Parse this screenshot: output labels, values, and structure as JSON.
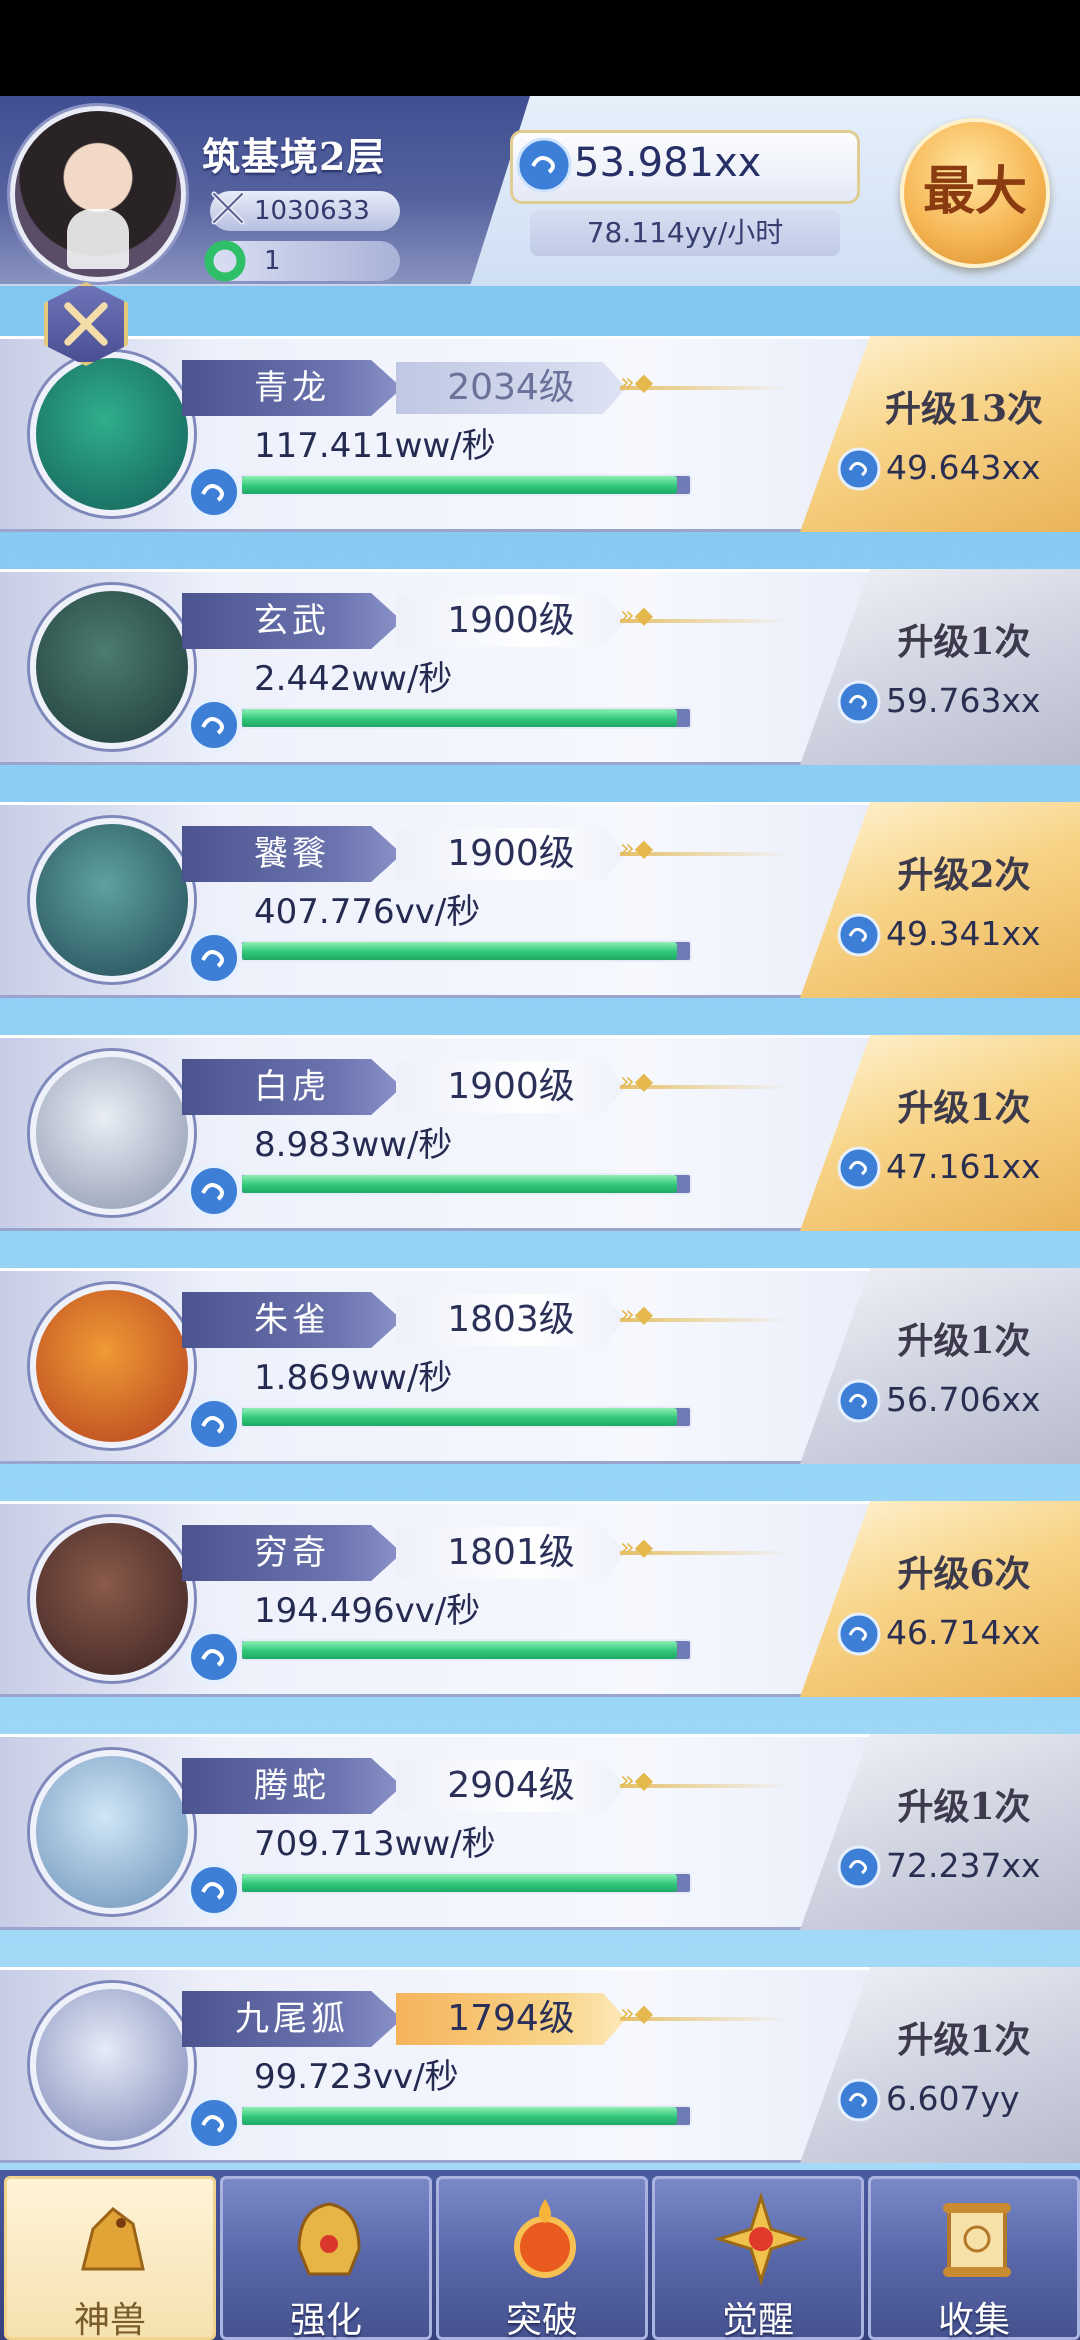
{
  "player": {
    "realm": "筑基境2层",
    "power": "1030633",
    "jade": "1"
  },
  "currency": {
    "amount": "53.981xx",
    "rate": "78.114yy/小时",
    "max_button": "最大"
  },
  "beasts": [
    {
      "name": "青龙",
      "level": "2034级",
      "rate": "117.411ww/秒",
      "upgrade": "升级13次",
      "cost": "49.643xx",
      "panel": "gold",
      "level_style": "dim",
      "progress": 0.97
    },
    {
      "name": "玄武",
      "level": "1900级",
      "rate": "2.442ww/秒",
      "upgrade": "升级1次",
      "cost": "59.763xx",
      "panel": "gray",
      "level_style": "normal",
      "progress": 0.97
    },
    {
      "name": "饕餮",
      "level": "1900级",
      "rate": "407.776vv/秒",
      "upgrade": "升级2次",
      "cost": "49.341xx",
      "panel": "gold",
      "level_style": "normal",
      "progress": 0.97
    },
    {
      "name": "白虎",
      "level": "1900级",
      "rate": "8.983ww/秒",
      "upgrade": "升级1次",
      "cost": "47.161xx",
      "panel": "gold",
      "level_style": "normal",
      "progress": 0.97
    },
    {
      "name": "朱雀",
      "level": "1803级",
      "rate": "1.869ww/秒",
      "upgrade": "升级1次",
      "cost": "56.706xx",
      "panel": "gray",
      "level_style": "normal",
      "progress": 0.97
    },
    {
      "name": "穷奇",
      "level": "1801级",
      "rate": "194.496vv/秒",
      "upgrade": "升级6次",
      "cost": "46.714xx",
      "panel": "gold",
      "level_style": "normal",
      "progress": 0.97
    },
    {
      "name": "腾蛇",
      "level": "2904级",
      "rate": "709.713ww/秒",
      "upgrade": "升级1次",
      "cost": "72.237xx",
      "panel": "gray",
      "level_style": "normal",
      "progress": 0.97
    },
    {
      "name": "九尾狐",
      "level": "1794级",
      "rate": "99.723vv/秒",
      "upgrade": "升级1次",
      "cost": "6.607yy",
      "panel": "gray",
      "level_style": "highlight",
      "progress": 0.97
    }
  ],
  "nav": [
    {
      "label": "神兽",
      "active": true
    },
    {
      "label": "强化",
      "active": false
    },
    {
      "label": "突破",
      "active": false
    },
    {
      "label": "觉醒",
      "active": false
    },
    {
      "label": "收集",
      "active": false
    }
  ],
  "colors": {
    "background": "#8fd0f4",
    "header": "#56629e",
    "gold_panel": "#f8d488",
    "progress": "#32c77a"
  }
}
